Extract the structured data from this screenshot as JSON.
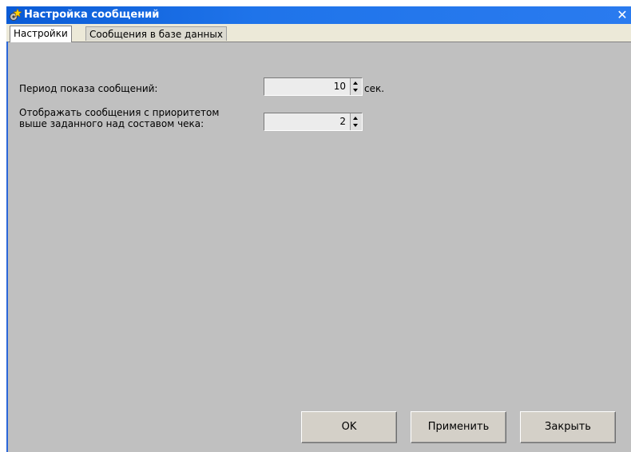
{
  "window": {
    "title": "Настройка сообщений",
    "icon": "settings-gear-icon",
    "close_glyph": "✕",
    "colors": {
      "titlebar": "#1f74ea",
      "body": "#c0c0c0"
    }
  },
  "tabs": [
    {
      "label": "Настройки",
      "active": true
    },
    {
      "label": "Сообщения в базе данных",
      "active": false
    }
  ],
  "settings": {
    "period_label": "Период показа сообщений:",
    "period_value": "10",
    "period_unit": "сек.",
    "priority_label_line1": "Отображать сообщения с приоритетом",
    "priority_label_line2": "выше заданного над составом чека:",
    "priority_value": "2"
  },
  "buttons": {
    "ok": "OK",
    "apply": "Применить",
    "close": "Закрыть"
  }
}
